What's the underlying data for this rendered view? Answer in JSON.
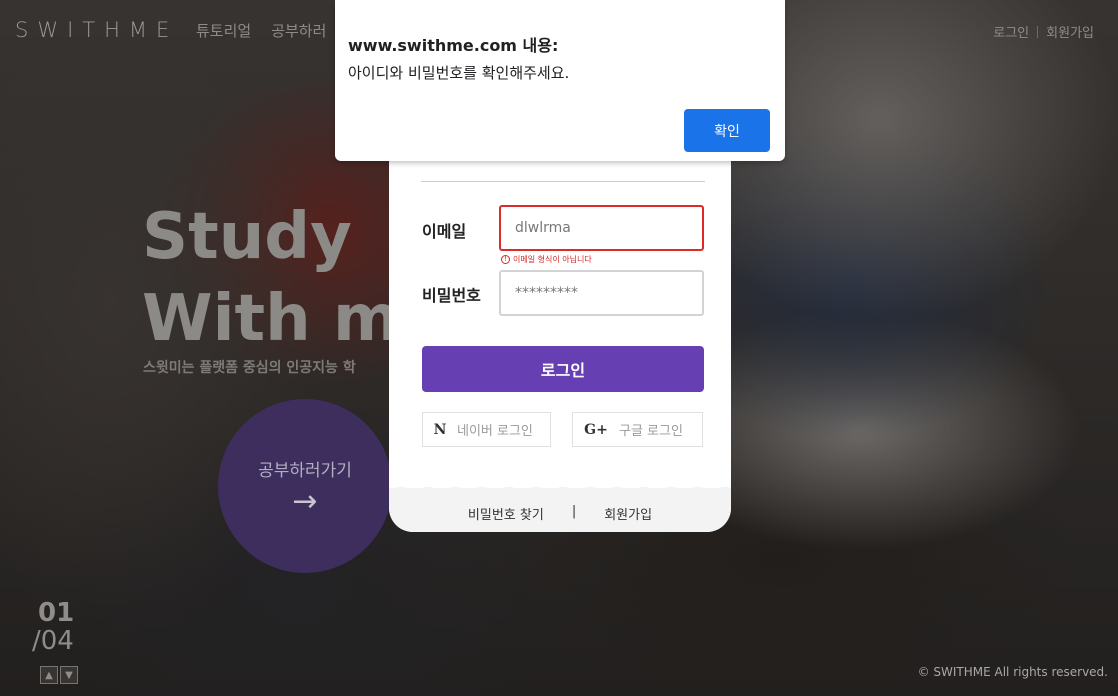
{
  "header": {
    "logo": "SWITHME",
    "nav": [
      "튜토리얼",
      "공부하러"
    ],
    "login_link": "로그인",
    "signup_link": "회원가입"
  },
  "hero": {
    "title_line1": "Study",
    "title_line2": "With me",
    "subtitle": "스윗미는 플랫폼 중심의 인공지능 학",
    "cta_label": "공부하러가기",
    "cta_arrow": "→",
    "slide_current": "01",
    "slide_total": "/04",
    "prev_icon": "▲",
    "next_icon": "▼"
  },
  "login": {
    "email_label": "이메일",
    "email_value": "dlwlrma",
    "email_error": "이메일 형식이 아닙니다",
    "error_icon": "!",
    "password_label": "비밀번호",
    "password_value": "*********",
    "submit_label": "로그인",
    "naver_icon": "N",
    "naver_label": "네이버 로그인",
    "google_icon": "G+",
    "google_label": "구글 로그인",
    "find_password": "비밀번호 찾기",
    "separator": "|",
    "signup": "회원가입"
  },
  "alert": {
    "title": "www.swithme.com 내용:",
    "message": "아이디와 비밀번호를 확인해주세요.",
    "ok_label": "확인",
    "button_color": "#1a73e8"
  },
  "footer": {
    "copyright": "© SWITHME All rights reserved."
  },
  "colors": {
    "accent_purple": "#6640b3",
    "error_red": "#dd2a2a"
  }
}
